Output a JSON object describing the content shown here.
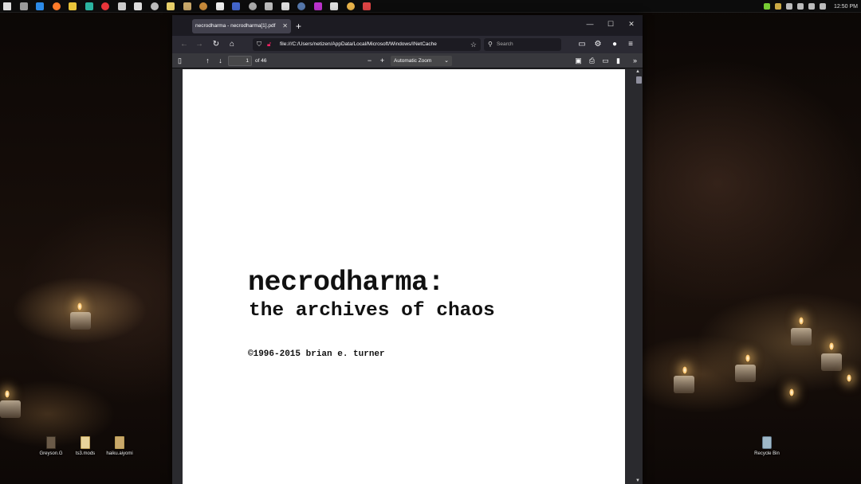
{
  "taskbar": {
    "pinned_icons": [
      "windows-start-icon",
      "settings-icon",
      "vscode-icon",
      "firefox-icon",
      "chrome-icon",
      "edge-icon",
      "vivaldi-icon",
      "app-icon",
      "app-icon",
      "app-icon",
      "app-icon",
      "app-icon",
      "app-icon",
      "app-icon",
      "app-icon",
      "app-icon",
      "app-icon",
      "app-icon",
      "app-icon",
      "app-icon",
      "app-icon",
      "app-icon",
      "app-icon"
    ],
    "clock": "12:50 PM"
  },
  "desktop": {
    "icons": [
      {
        "label": "Greyson.G"
      },
      {
        "label": "ts3.mods"
      },
      {
        "label": "haiku.aiyomi"
      },
      {
        "label": "Recycle Bin"
      }
    ]
  },
  "browser": {
    "tab_title": "necrodharma - necrodharma[1].pdf",
    "url": "file:///C:/Users/netizen/AppData/Local/Microsoft/Windows/INetCache",
    "search_placeholder": "Search"
  },
  "pdf_toolbar": {
    "page_number": "1",
    "page_count": "of 46",
    "zoom": "Automatic Zoom"
  },
  "document": {
    "title": "necrodharma:",
    "subtitle": "the archives of chaos",
    "copyright": "©1996-2015 brian e. turner"
  }
}
